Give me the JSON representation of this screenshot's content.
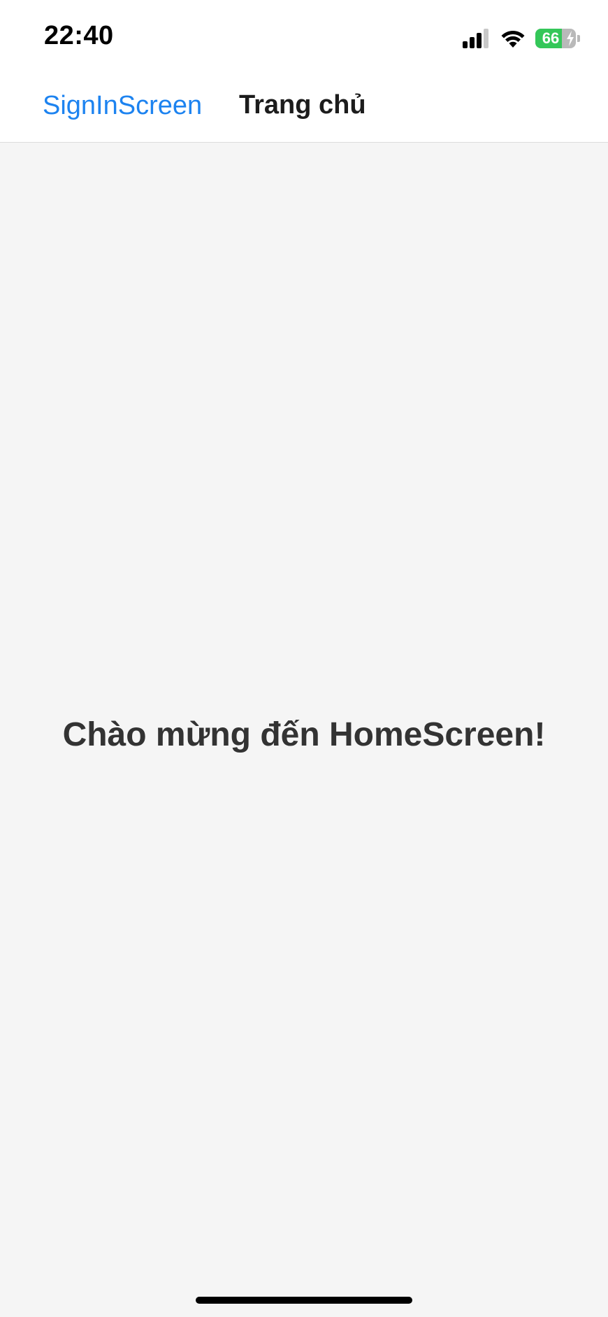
{
  "status_bar": {
    "time": "22:40",
    "battery_level": "66",
    "icons": [
      "cellular-signal-icon",
      "wifi-icon",
      "battery-icon",
      "charging-bolt-icon"
    ]
  },
  "nav": {
    "back_label": "SignInScreen",
    "title": "Trang chủ"
  },
  "content": {
    "welcome_text": "Chào mừng đến HomeScreen!"
  },
  "colors": {
    "accent": "#1d83f0",
    "battery_green": "#34c759",
    "background": "#f5f5f5",
    "text": "#333333"
  }
}
